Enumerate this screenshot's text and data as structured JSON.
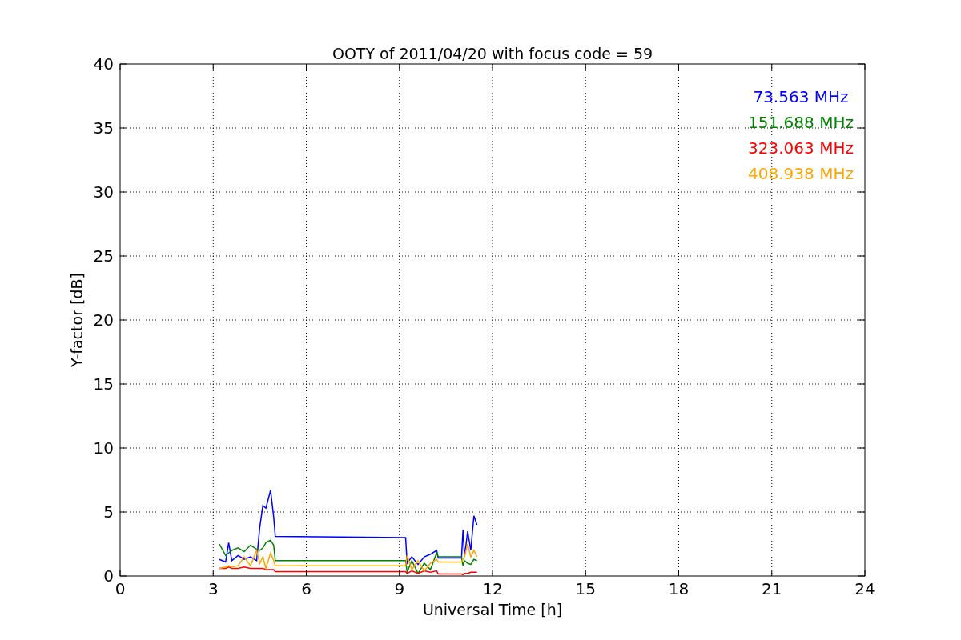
{
  "chart_data": {
    "type": "line",
    "title": "OOTY of 2011/04/20 with focus code = 59",
    "xlabel": "Universal Time [h]",
    "ylabel": "Y-factor [dB]",
    "x": [
      3.2,
      3.4,
      3.5,
      3.6,
      3.8,
      4.0,
      4.2,
      4.4,
      4.5,
      4.6,
      4.7,
      4.85,
      4.95,
      5.0,
      9.2,
      9.25,
      9.4,
      9.6,
      9.8,
      10.0,
      10.2,
      10.25,
      11.0,
      11.05,
      11.1,
      11.2,
      11.3,
      11.4,
      11.5
    ],
    "series": [
      {
        "name": "73.563 MHz",
        "color": "#0000ff",
        "values": [
          1.3,
          1.1,
          2.6,
          1.2,
          1.6,
          1.3,
          1.5,
          1.2,
          3.8,
          5.5,
          5.3,
          6.7,
          4.6,
          3.1,
          3.0,
          1.0,
          1.5,
          0.9,
          1.5,
          1.7,
          2.0,
          1.4,
          1.4,
          3.6,
          1.5,
          3.5,
          2.0,
          4.7,
          4.0
        ]
      },
      {
        "name": "151.688 MHz",
        "color": "#008000",
        "values": [
          2.5,
          1.6,
          1.8,
          2.0,
          2.2,
          1.9,
          2.4,
          2.1,
          2.0,
          2.2,
          2.6,
          2.8,
          2.4,
          1.2,
          1.2,
          0.3,
          1.2,
          0.2,
          1.0,
          0.5,
          1.8,
          1.5,
          1.5,
          0.8,
          1.2,
          1.0,
          0.9,
          1.3,
          1.2
        ]
      },
      {
        "name": "323.063 MHz",
        "color": "#ff0000",
        "values": [
          0.6,
          0.6,
          0.7,
          0.6,
          0.6,
          0.7,
          0.6,
          0.6,
          0.6,
          0.6,
          0.5,
          0.5,
          0.5,
          0.35,
          0.35,
          0.2,
          0.4,
          0.2,
          0.4,
          0.3,
          0.4,
          0.15,
          0.15,
          0.1,
          0.2,
          0.2,
          0.3,
          0.3,
          0.3
        ]
      },
      {
        "name": "408.938 MHz",
        "color": "#ffa500",
        "values": [
          0.6,
          0.7,
          0.8,
          0.7,
          0.8,
          1.5,
          0.8,
          2.0,
          1.0,
          1.5,
          0.6,
          1.8,
          1.2,
          0.8,
          0.8,
          1.6,
          0.5,
          1.2,
          0.4,
          1.0,
          1.3,
          1.1,
          1.1,
          1.3,
          1.5,
          2.5,
          1.5,
          2.0,
          1.5
        ]
      }
    ],
    "xlim": [
      0,
      24
    ],
    "ylim": [
      0,
      40
    ],
    "xticks": [
      0,
      3,
      6,
      9,
      12,
      15,
      18,
      21,
      24
    ],
    "yticks": [
      0,
      5,
      10,
      15,
      20,
      25,
      30,
      35,
      40
    ],
    "grid": true
  }
}
